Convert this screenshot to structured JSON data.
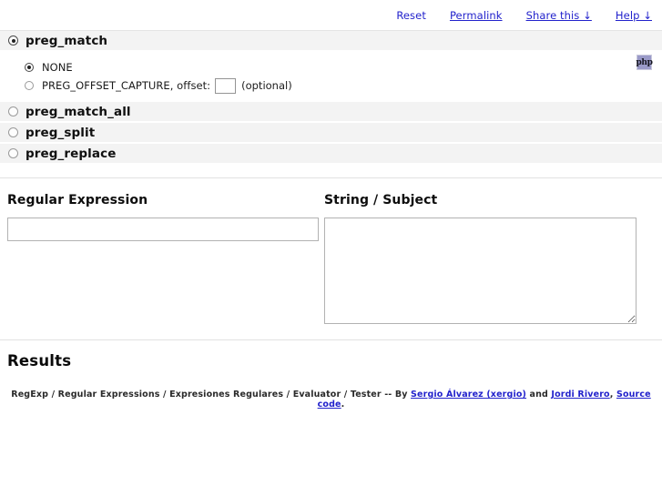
{
  "topbar": {
    "links": [
      {
        "label": "Reset",
        "underline": false
      },
      {
        "label": "Permalink",
        "underline": true
      },
      {
        "label": "Share this ↓",
        "underline": true
      },
      {
        "label": "Help ↓",
        "underline": true
      }
    ]
  },
  "functions": {
    "selected": "preg_match",
    "options": [
      {
        "label": "preg_match",
        "checked": true
      },
      {
        "label": "preg_match_all",
        "checked": false
      },
      {
        "label": "preg_split",
        "checked": false
      },
      {
        "label": "preg_replace",
        "checked": false
      }
    ]
  },
  "flags": {
    "selected": "NONE",
    "none_label": "NONE",
    "offset_label": "PREG_OFFSET_CAPTURE, offset:",
    "offset_value": "",
    "offset_placeholder": "",
    "optional_label": "(optional)",
    "php_badge_label": "php"
  },
  "fields": {
    "regex": {
      "label": "Regular Expression",
      "value": "",
      "placeholder": ""
    },
    "subject": {
      "label": "String / Subject",
      "value": "",
      "placeholder": ""
    }
  },
  "results": {
    "title": "Results",
    "body": ""
  },
  "footer": {
    "prefix": "RegExp / Regular Expressions / Expresiones Regulares / Evaluator / Tester -- By ",
    "author1": "Sergio Álvarez (xergio)",
    "joiner": " and ",
    "author2": "Jordi Rivero",
    "sep": ", ",
    "source": "Source code",
    "suffix": "."
  },
  "colors": {
    "link": "#2222cc",
    "row_bg": "#f3f3f3",
    "rule": "#e2e2e2",
    "php_badge_bg": "#9a9ac8",
    "input_border": "#b2b2b2"
  }
}
